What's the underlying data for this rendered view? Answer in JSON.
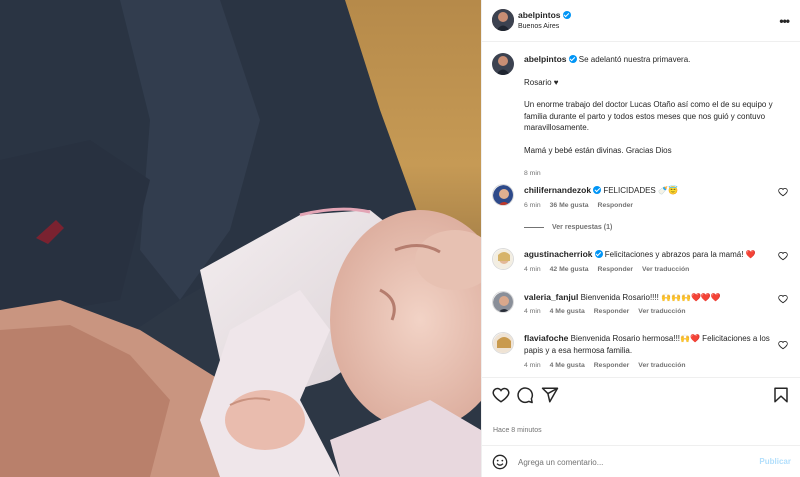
{
  "header": {
    "username": "abelpintos",
    "location": "Buenos Aires",
    "more_icon": "more-horizontal-icon"
  },
  "caption": {
    "username": "abelpintos",
    "lines": [
      "Se adelantó nuestra primavera.",
      "Rosario ♥",
      "Un enorme trabajo del doctor Lucas Otaño así como el de su equipo y familia durante el parto y todos estos meses que nos guió y contuvo maravillosamente.",
      "Mamá y bebé están divinas. Gracias Dios"
    ],
    "time": "8 min"
  },
  "comments": [
    {
      "username": "chilifernandezok",
      "verified": true,
      "text": "FELICIDADES 🍼😇",
      "time": "6 min",
      "likes": "36 Me gusta",
      "reply": "Responder",
      "see_replies": "Ver respuestas (1)"
    },
    {
      "username": "agustinacherriok",
      "verified": true,
      "text": "Felicitaciones y abrazos para la mamá! ❤️",
      "time": "4 min",
      "likes": "42 Me gusta",
      "reply": "Responder",
      "translate": "Ver traducción"
    },
    {
      "username": "valeria_fanjul",
      "verified": false,
      "text": "Bienvenida Rosario!!!! 🙌🙌🙌❤️❤️❤️",
      "time": "4 min",
      "likes": "4 Me gusta",
      "reply": "Responder",
      "translate": "Ver traducción"
    },
    {
      "username": "flaviafoche",
      "verified": false,
      "text": "Bienvenida Rosario hermosa!!!🙌❤️ Felicitaciones a los papis y a esa hermosa familia.",
      "time": "4 min",
      "likes": "4 Me gusta",
      "reply": "Responder",
      "translate": "Ver traducción"
    }
  ],
  "actions": {
    "like_icon": "heart-icon",
    "comment_icon": "comment-icon",
    "share_icon": "share-icon",
    "save_icon": "bookmark-icon",
    "posted_time": "Hace 8 minutos"
  },
  "add_comment": {
    "emoji_icon": "emoji-icon",
    "placeholder": "Agrega un comentario...",
    "publish_label": "Publicar"
  },
  "colors": {
    "accent": "#0095f6",
    "publish_disabled": "#b2dffc",
    "muted_text": "#737373",
    "heart_red": "#ed4956"
  }
}
